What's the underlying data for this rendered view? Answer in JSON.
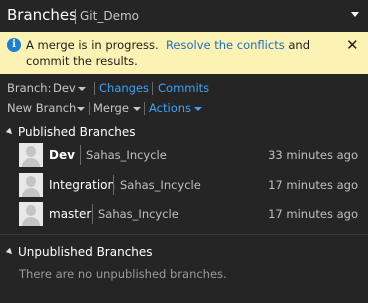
{
  "header": {
    "title": "Branches",
    "repo": "Git_Demo"
  },
  "banner": {
    "text_before": "A merge is in progress.",
    "link": "Resolve the conflicts",
    "text_after": "and commit the results.",
    "close": "✕"
  },
  "toolbar": {
    "branch_label": "Branch:",
    "branch_value": "Dev",
    "changes": "Changes",
    "commits": "Commits",
    "new_branch": "New Branch",
    "merge": "Merge",
    "actions": "Actions"
  },
  "published": {
    "title": "Published Branches",
    "branches": [
      {
        "name": "Dev",
        "author": "Sahas_Incycle",
        "time": "33 minutes ago",
        "current": true
      },
      {
        "name": "Integration",
        "author": "Sahas_Incycle",
        "time": "17 minutes ago",
        "current": false
      },
      {
        "name": "master",
        "author": "Sahas_Incycle",
        "time": "17 minutes ago",
        "current": false
      }
    ]
  },
  "unpublished": {
    "title": "Unpublished Branches",
    "empty": "There are no unpublished branches."
  },
  "colors": {
    "background": "#252526",
    "banner": "#fcf2b4",
    "link": "#3fa2f7",
    "info": "#1c7fd6"
  }
}
